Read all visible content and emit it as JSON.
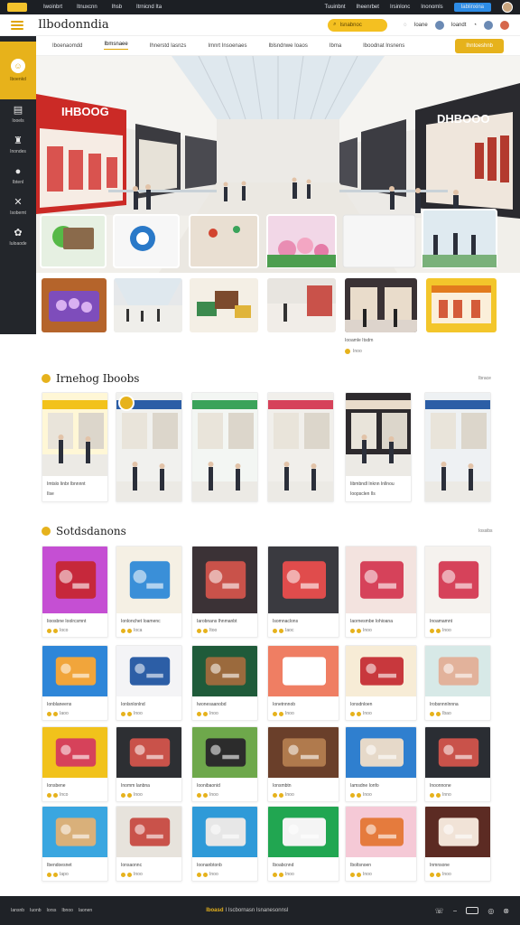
{
  "topbar": {
    "nav": [
      "Iwoinbrt",
      "Itnuxcnn",
      "Ihsb",
      "Itrnicnd Ita"
    ],
    "right": [
      "Tuuinbnt",
      "Iheenrbet",
      "Irsinlonc",
      "Inonomls"
    ],
    "badge": "Iablinxina"
  },
  "header": {
    "brand": "Ilbodonndia",
    "search_placeholder": "Isnabnoc",
    "icons": [
      "Ioane",
      "Ioandt"
    ]
  },
  "nav": {
    "items": [
      "Iboenaomdd",
      "Ibmsnaee",
      "Ihnerstd Iasnzs",
      "Imnrt Insoenaes",
      "Iblsndnwe Ioaos",
      "Ibma",
      "Iboodnat Insnens"
    ],
    "cta": "Ihntoeshnb"
  },
  "sidebar": {
    "top_label": "Iboenkd",
    "items": [
      {
        "label": "Iooels",
        "icon": "grid-icon"
      },
      {
        "label": "Inondes",
        "icon": "shop-icon"
      },
      {
        "label": "Ibtenl",
        "icon": "chat-icon"
      },
      {
        "label": "Isobemt",
        "icon": "bike-icon"
      },
      {
        "label": "Iuloaode",
        "icon": "gear-icon"
      }
    ]
  },
  "hero": {
    "storefront_left": "IHBOOG",
    "storefront_right": "DHBOOO"
  },
  "promo": {
    "caption": "Iooamle Itsdm",
    "rating": "Inoo"
  },
  "section1": {
    "title": "Irnehog Iboobs",
    "more": "Ibrace",
    "cards": [
      {
        "caption": "Imtslo Iinbr Ibnnnnt",
        "sub": "Ilse"
      },
      {
        "caption": "",
        "sub": ""
      },
      {
        "caption": "",
        "sub": ""
      },
      {
        "caption": "",
        "sub": ""
      },
      {
        "caption": "Iibmbndl Inknn Inllnou",
        "sub": "Ioopsclen Ils"
      },
      {
        "caption": "",
        "sub": ""
      }
    ]
  },
  "section2": {
    "title": "Sotdsdanons",
    "more": "Iossibs",
    "cards": [
      {
        "caption": "Iioosbne Ioolrcsmnt",
        "rating": "Ioco"
      },
      {
        "caption": "Ionlonchet Ioamenc",
        "rating": "Ioca"
      },
      {
        "caption": "Iarobnans Ihnmanbt",
        "rating": "Itoo"
      },
      {
        "caption": "Isomnaclons",
        "rating": "Iaoc"
      },
      {
        "caption": "Iaornesmbe Iohioana",
        "rating": "Inoo"
      },
      {
        "caption": "Inoamamnt",
        "rating": "Inoo"
      },
      {
        "caption": "Ionblaneens",
        "rating": "Iaoo"
      },
      {
        "caption": "Ionlsnlonlnd",
        "rating": "Inoo"
      },
      {
        "caption": "Iwonesaanobd",
        "rating": "Inoo"
      },
      {
        "caption": "Ionetnnnob",
        "rating": "Inoo"
      },
      {
        "caption": "Ionsdnloen",
        "rating": "Inoo"
      },
      {
        "caption": "Irobsnnnlnnna",
        "rating": "Ibao"
      },
      {
        "caption": "Ionsbene",
        "rating": "Inco"
      },
      {
        "caption": "Inomm Ianbna",
        "rating": "Inoo"
      },
      {
        "caption": "Ioonibaonid",
        "rating": "Inoo"
      },
      {
        "caption": "Ionsmbtn",
        "rating": "Inoo"
      },
      {
        "caption": "Iamsdne Ionfo",
        "rating": "Inoo"
      },
      {
        "caption": "Inoonnone",
        "rating": "Inno"
      },
      {
        "caption": "Ibendoesnet",
        "rating": "Iapo"
      },
      {
        "caption": "Ionsaonnc",
        "rating": "Inoo"
      },
      {
        "caption": "Ioonanbtonb",
        "rating": "Inoo"
      },
      {
        "caption": "Iboabcnnd",
        "rating": "Inoo"
      },
      {
        "caption": "Iboltsnoen",
        "rating": "Inoo"
      },
      {
        "caption": "Inmnsone",
        "rating": "Inoo"
      }
    ]
  },
  "footer": {
    "links": [
      "Iansnb",
      "Iuonb",
      "Iorss",
      "Ibnoo",
      "Iaonen"
    ],
    "center": "Iboasd",
    "center_rest": "I Iscbornasn Isnanesonnsl"
  }
}
